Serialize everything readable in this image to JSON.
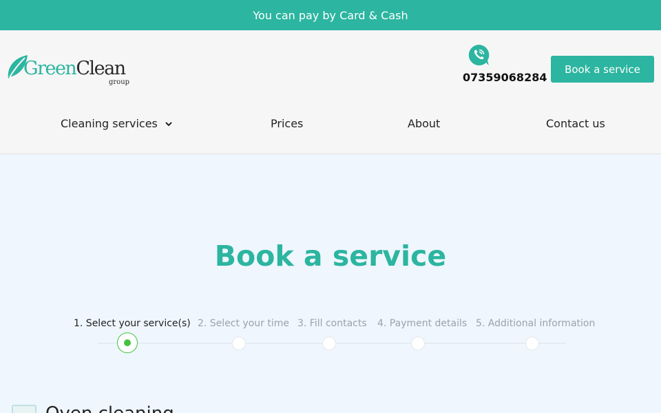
{
  "topbar": {
    "text": "You can pay by Card & Cash"
  },
  "logo": {
    "word1": "Green",
    "word2": "Clean",
    "sub": "group"
  },
  "header": {
    "phone": "07359068284",
    "book_button": "Book a service"
  },
  "nav": [
    {
      "label": "Cleaning services",
      "has_dropdown": true
    },
    {
      "label": "Prices"
    },
    {
      "label": "About"
    },
    {
      "label": "Contact us"
    }
  ],
  "page": {
    "title": "Book a service"
  },
  "steps": [
    {
      "label": "1. Select your service(s)",
      "active": true
    },
    {
      "label": "2. Select your time",
      "active": false
    },
    {
      "label": "3. Fill contacts",
      "active": false
    },
    {
      "label": "4. Payment details",
      "active": false
    },
    {
      "label": "5. Additional information",
      "active": false
    }
  ],
  "section": {
    "heading": "Oven cleaning"
  },
  "colors": {
    "brand": "#2cb5a0",
    "step_active": "#44c23e",
    "background": "#eff6fd"
  }
}
